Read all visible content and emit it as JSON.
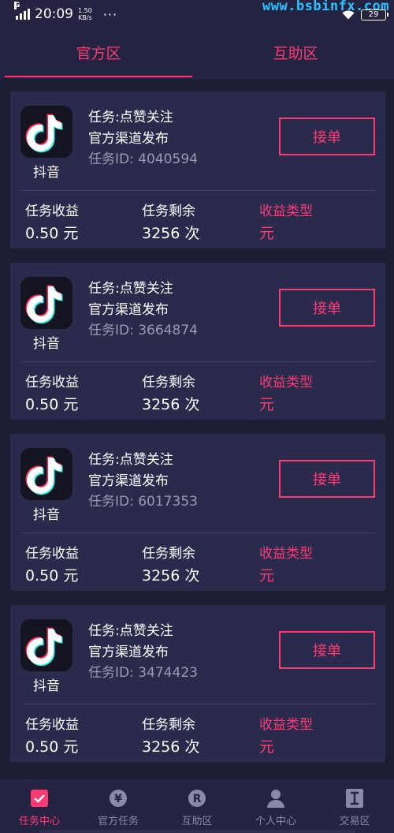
{
  "status_bar": {
    "network": "G",
    "time": "20:09",
    "speed_value": "1.50",
    "speed_unit": "KB/s",
    "more": "···",
    "battery": "29",
    "watermark": "www.bsbinfx.com"
  },
  "tabs": [
    {
      "label": "官方区",
      "active": true
    },
    {
      "label": "互助区",
      "active": false
    }
  ],
  "tasks": [
    {
      "app_name": "抖音",
      "type": "任务:点赞关注",
      "channel": "官方渠道发布",
      "task_id": "任务ID:  4040594",
      "button": "接单",
      "income_label": "任务收益",
      "income_value": "0.50 元",
      "remain_label": "任务剩余",
      "remain_value": "3256 次",
      "type_label": "收益类型",
      "type_value": "元"
    },
    {
      "app_name": "抖音",
      "type": "任务:点赞关注",
      "channel": "官方渠道发布",
      "task_id": "任务ID:  3664874",
      "button": "接单",
      "income_label": "任务收益",
      "income_value": "0.50 元",
      "remain_label": "任务剩余",
      "remain_value": "3256 次",
      "type_label": "收益类型",
      "type_value": "元"
    },
    {
      "app_name": "抖音",
      "type": "任务:点赞关注",
      "channel": "官方渠道发布",
      "task_id": "任务ID:  6017353",
      "button": "接单",
      "income_label": "任务收益",
      "income_value": "0.50 元",
      "remain_label": "任务剩余",
      "remain_value": "3256 次",
      "type_label": "收益类型",
      "type_value": "元"
    },
    {
      "app_name": "抖音",
      "type": "任务:点赞关注",
      "channel": "官方渠道发布",
      "task_id": "任务ID:  3474423",
      "button": "接单",
      "income_label": "任务收益",
      "income_value": "0.50 元",
      "remain_label": "任务剩余",
      "remain_value": "3256 次",
      "type_label": "收益类型",
      "type_value": "元"
    }
  ],
  "bottom_nav": [
    {
      "label": "任务中心",
      "icon": "check-square-icon",
      "active": true
    },
    {
      "label": "官方任务",
      "icon": "yen-circle-icon",
      "active": false
    },
    {
      "label": "互助区",
      "icon": "registered-circle-icon",
      "active": false
    },
    {
      "label": "个人中心",
      "icon": "person-icon",
      "active": false
    },
    {
      "label": "交易区",
      "icon": "roman-one-icon",
      "active": false
    }
  ],
  "colors": {
    "accent": "#ff3a73",
    "background": "#1d1d33",
    "card": "#2a2a4d",
    "bar": "#242442",
    "muted": "#9a9ab0"
  }
}
